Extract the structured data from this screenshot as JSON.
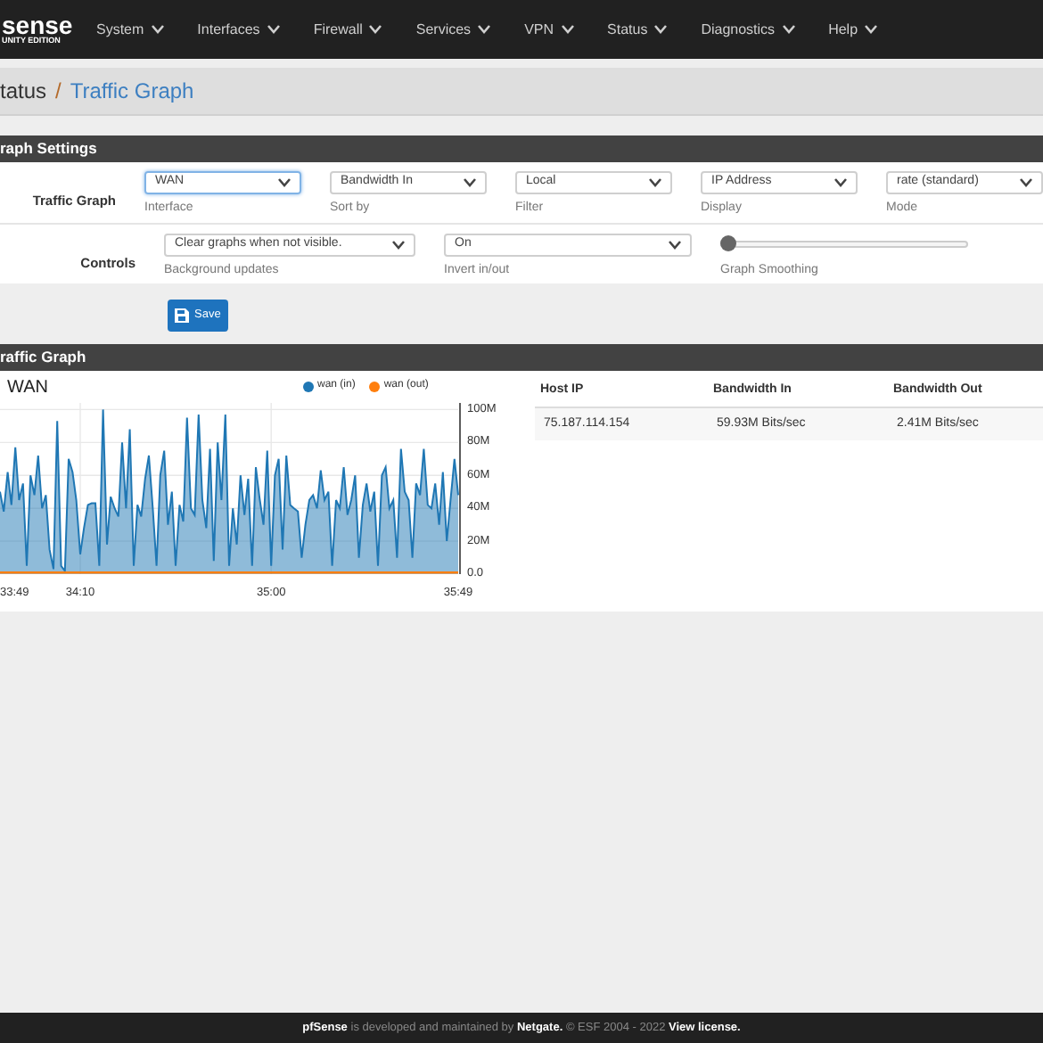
{
  "navbar": {
    "logo": "sense",
    "logo_subtitle": "UNITY EDITION",
    "menu": [
      {
        "label": "System"
      },
      {
        "label": "Interfaces"
      },
      {
        "label": "Firewall"
      },
      {
        "label": "Services"
      },
      {
        "label": "VPN"
      },
      {
        "label": "Status"
      },
      {
        "label": "Diagnostics"
      },
      {
        "label": "Help"
      }
    ]
  },
  "breadcrumb": {
    "parent": "tatus",
    "separator": "/",
    "current": "Traffic Graph"
  },
  "settings_panel": {
    "title": "raph Settings",
    "rows": [
      {
        "label": "Traffic Graph",
        "controls": [
          {
            "kind": "select",
            "value": "WAN",
            "caption": "Interface",
            "focused": true
          },
          {
            "kind": "select",
            "value": "Bandwidth In",
            "caption": "Sort by",
            "focused": false
          },
          {
            "kind": "select",
            "value": "Local",
            "caption": "Filter",
            "focused": false
          },
          {
            "kind": "select",
            "value": "IP Address",
            "caption": "Display",
            "focused": false
          },
          {
            "kind": "select",
            "value": "rate (standard)",
            "caption": "Mode",
            "focused": false
          }
        ]
      },
      {
        "label": "Controls",
        "controls": [
          {
            "kind": "select",
            "value": "Clear graphs when not visible.",
            "caption": "Background updates",
            "focused": false
          },
          {
            "kind": "select",
            "value": "On",
            "caption": "Invert in/out",
            "focused": false
          },
          {
            "kind": "slider",
            "level": 0,
            "caption": "Graph Smoothing"
          }
        ]
      }
    ],
    "save_button": "Save"
  },
  "graph_panel": {
    "title": "raffic Graph",
    "graph": {
      "title": "WAN",
      "chart_data": {
        "type": "area",
        "grid": true,
        "legend": "top-right",
        "x": [
          2029,
          2030,
          2031,
          2032,
          2033,
          2034,
          2035,
          2036,
          2037,
          2038,
          2039,
          2040,
          2041,
          2042,
          2043,
          2044,
          2045,
          2046,
          2047,
          2048,
          2049,
          2050,
          2051,
          2052,
          2053,
          2054,
          2055,
          2056,
          2057,
          2058,
          2059,
          2060,
          2061,
          2062,
          2063,
          2064,
          2065,
          2066,
          2067,
          2068,
          2069,
          2070,
          2071,
          2072,
          2073,
          2074,
          2075,
          2076,
          2077,
          2078,
          2079,
          2080,
          2081,
          2082,
          2083,
          2084,
          2085,
          2086,
          2087,
          2088,
          2089,
          2090,
          2091,
          2092,
          2093,
          2094,
          2095,
          2096,
          2097,
          2098,
          2099,
          2100,
          2101,
          2102,
          2103,
          2104,
          2105,
          2106,
          2107,
          2108,
          2109,
          2110,
          2111,
          2112,
          2113,
          2114,
          2115,
          2116,
          2117,
          2118,
          2119,
          2120,
          2121,
          2122,
          2123,
          2124,
          2125,
          2126,
          2127,
          2128,
          2129,
          2130,
          2131,
          2132,
          2133,
          2134,
          2135,
          2136,
          2137,
          2138,
          2139,
          2140,
          2141,
          2142,
          2143,
          2144,
          2145,
          2146,
          2147,
          2148,
          2149
        ],
        "series": [
          {
            "name": "wan (in)",
            "color": "#1f77b4",
            "type": "area",
            "values": [
              50,
              38,
              62,
              42,
              77,
              45,
              55,
              5,
              60,
              48,
              72,
              40,
              48,
              15,
              3,
              93,
              5,
              2,
              70,
              62,
              45,
              12,
              28,
              42,
              43,
              43,
              5,
              100,
              18,
              47,
              40,
              35,
              80,
              40,
              88,
              5,
              42,
              35,
              58,
              72,
              40,
              5,
              60,
              75,
              30,
              50,
              5,
              42,
              32,
              95,
              40,
              36,
              97,
              45,
              28,
              76,
              8,
              80,
              45,
              97,
              5,
              40,
              18,
              60,
              36,
              58,
              5,
              65,
              46,
              30,
              75,
              5,
              60,
              70,
              15,
              72,
              42,
              40,
              38,
              10,
              30,
              45,
              48,
              40,
              63,
              45,
              50,
              5,
              45,
              40,
              65,
              36,
              45,
              60,
              10,
              42,
              55,
              38,
              50,
              5,
              60,
              65,
              40,
              45,
              10,
              76,
              50,
              45,
              10,
              55,
              48,
              76,
              42,
              40,
              55,
              30,
              62,
              20,
              45,
              70,
              48
            ]
          },
          {
            "name": "wan (out)",
            "color": "#ff7f0e",
            "type": "line",
            "values": [
              1,
              1,
              1,
              1,
              1,
              1,
              1,
              1,
              1,
              1,
              1,
              1,
              1,
              1,
              1,
              1,
              1,
              1,
              1,
              1,
              1,
              1,
              1,
              1,
              1,
              1,
              1,
              1,
              1,
              1,
              1,
              1,
              1,
              1,
              1,
              1,
              1,
              1,
              1,
              1,
              1,
              1,
              1,
              1,
              1,
              1,
              1,
              1,
              1,
              1,
              1,
              1,
              1,
              1,
              1,
              1,
              1,
              1,
              1,
              1,
              1,
              1,
              1,
              1,
              1,
              1,
              1,
              1,
              1,
              1,
              1,
              1,
              1,
              1,
              1,
              1,
              1,
              1,
              1,
              1,
              1,
              1,
              1,
              1,
              1,
              1,
              1,
              1,
              1,
              1,
              1,
              1,
              1,
              1,
              1,
              1,
              1,
              1,
              1,
              1,
              1,
              1,
              1,
              1,
              1,
              1,
              1,
              1,
              1,
              1,
              1,
              1,
              1,
              1,
              1,
              1,
              1,
              1,
              1,
              1,
              1
            ]
          }
        ],
        "xlim": [
          2029,
          2149
        ],
        "ylim": [
          0,
          104
        ],
        "yticks": [
          {
            "value": 100,
            "label": "100M"
          },
          {
            "value": 80,
            "label": "80M"
          },
          {
            "value": 60,
            "label": "60M"
          },
          {
            "value": 40,
            "label": "40M"
          },
          {
            "value": 20,
            "label": "20M"
          },
          {
            "value": 0,
            "label": "0.0"
          }
        ],
        "xticks": [
          {
            "value": 2029,
            "label": "33:49"
          },
          {
            "value": 2050,
            "label": "34:10"
          },
          {
            "value": 2100,
            "label": "35:00"
          },
          {
            "value": 2149,
            "label": "35:49"
          }
        ]
      }
    },
    "table": {
      "columns": [
        "Host IP",
        "Bandwidth In",
        "Bandwidth Out"
      ],
      "rows": [
        [
          "75.187.114.154",
          "59.93M Bits/sec",
          "2.41M Bits/sec"
        ]
      ]
    }
  },
  "footer": {
    "text": "**pfSense** is developed and maintained by **Netgate.** © ESF 2004 - 2022 ",
    "link": "View license."
  }
}
